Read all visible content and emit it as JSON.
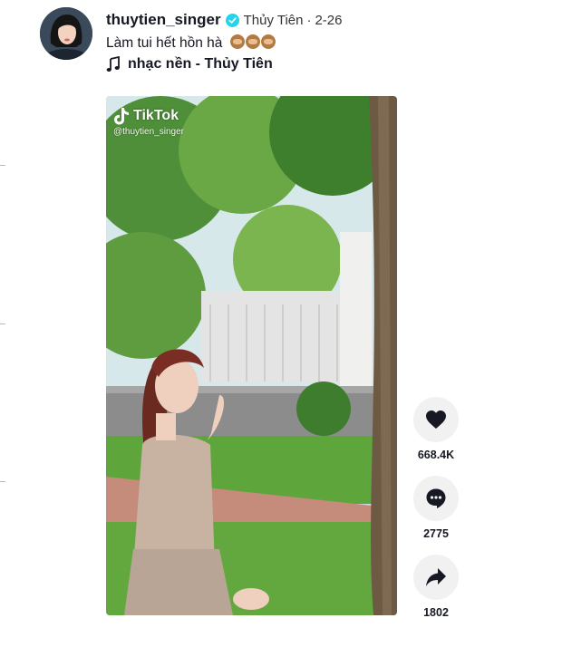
{
  "post": {
    "username": "thuytien_singer",
    "nickname": "Thủy Tiên",
    "separator": "·",
    "date": "2-26",
    "caption": "Làm tui hết hồn hà",
    "caption_emoji": "see-no-evil-monkey-icon",
    "music": "nhạc nền - Thủy Tiên"
  },
  "video": {
    "watermark_brand": "TikTok",
    "watermark_handle": "@thuytien_singer"
  },
  "actions": {
    "likes": "668.4K",
    "comments": "2775",
    "shares": "1802"
  },
  "colors": {
    "verified_badge": "#20d5ec",
    "action_button_bg": "#f1f1f2",
    "text": "#161823"
  }
}
